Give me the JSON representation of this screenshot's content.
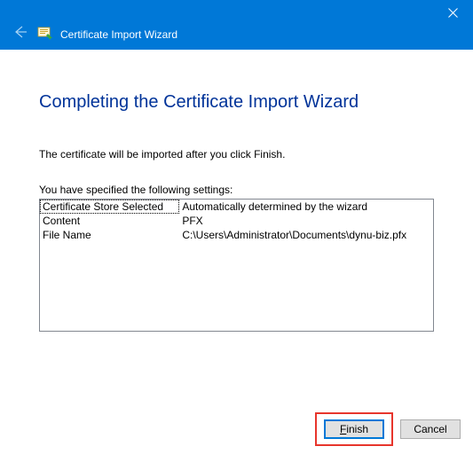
{
  "titlebar": {
    "title": "Certificate Import Wizard"
  },
  "main": {
    "heading": "Completing the Certificate Import Wizard",
    "body_text": "The certificate will be imported after you click Finish.",
    "settings_label": "You have specified the following settings:",
    "rows": [
      {
        "k": "Certificate Store Selected",
        "v": "Automatically determined by the wizard"
      },
      {
        "k": "Content",
        "v": "PFX"
      },
      {
        "k": "File Name",
        "v": "C:\\Users\\Administrator\\Documents\\dynu-biz.pfx"
      }
    ]
  },
  "buttons": {
    "finish_u": "F",
    "finish_rest": "inish",
    "cancel": "Cancel"
  }
}
